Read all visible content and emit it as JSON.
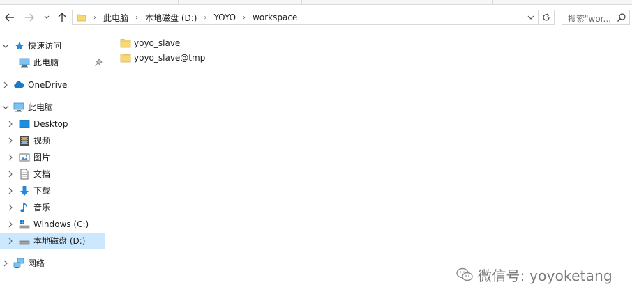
{
  "address": {
    "crumbs": [
      "此电脑",
      "本地磁盘 (D:)",
      "YOYO",
      "workspace"
    ]
  },
  "search": {
    "placeholder": "搜索\"wor..."
  },
  "nav": {
    "quick_access": "快速访问",
    "this_pc_pinned": "此电脑",
    "onedrive": "OneDrive",
    "this_pc": "此电脑",
    "desktop": "Desktop",
    "videos": "视频",
    "pictures": "图片",
    "documents": "文档",
    "downloads": "下载",
    "music": "音乐",
    "drive_c": "Windows (C:)",
    "drive_d": "本地磁盘 (D:)",
    "network": "网络"
  },
  "files": [
    {
      "name": "yoyo_slave",
      "icon": "folder-icon"
    },
    {
      "name": "yoyo_slave@tmp",
      "icon": "folder-icon"
    }
  ],
  "watermark": {
    "text": "微信号: yoyoketang"
  },
  "colors": {
    "selection": "#cce8ff",
    "folder": "#f8d775",
    "accent": "#1979ca"
  }
}
